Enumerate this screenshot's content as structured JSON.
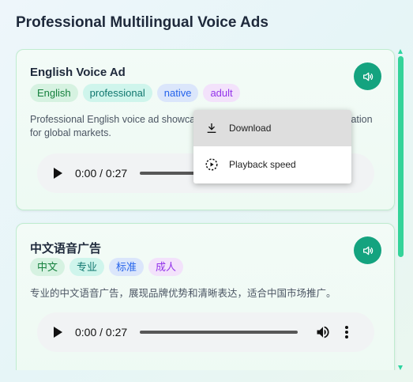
{
  "page": {
    "title": "Professional Multilingual Voice Ads"
  },
  "ads": [
    {
      "title": "English Voice Ad",
      "tags": [
        "English",
        "professional",
        "native",
        "adult"
      ],
      "description": "Professional English voice ad showcasing brand benefits and clear articulation for global markets.",
      "audio": {
        "time": "0:00 / 0:27"
      }
    },
    {
      "title": "中文语音广告",
      "tags": [
        "中文",
        "专业",
        "标准",
        "成人"
      ],
      "description": "专业的中文语音广告，展现品牌优势和清晰表达，适合中国市场推广。",
      "audio": {
        "time": "0:00 / 0:27"
      }
    }
  ],
  "menu": {
    "items": [
      {
        "label": "Download",
        "icon": "download-icon"
      },
      {
        "label": "Playback speed",
        "icon": "playback-speed-icon"
      }
    ]
  },
  "colors": {
    "accent": "#14a37f",
    "scrollbar": "#34d399"
  }
}
